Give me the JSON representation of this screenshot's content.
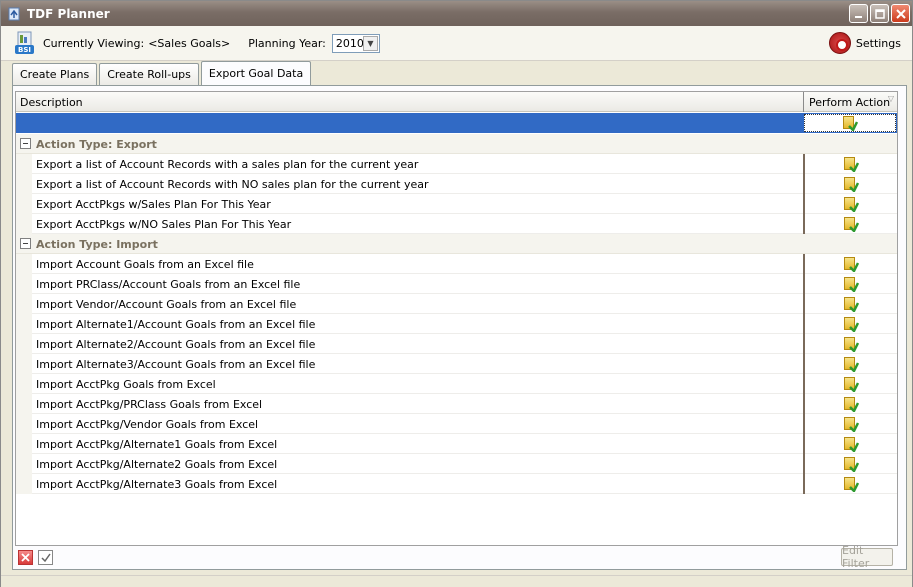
{
  "window": {
    "title": "TDF Planner"
  },
  "toolbar": {
    "viewing_label": "Currently Viewing:",
    "viewing_value": "<Sales Goals>",
    "year_label": "Planning Year:",
    "year_value": "2010",
    "settings_label": "Settings"
  },
  "tabs": [
    {
      "label": "Create Plans"
    },
    {
      "label": "Create Roll-ups"
    },
    {
      "label": "Export Goal Data"
    }
  ],
  "grid": {
    "columns": {
      "description": "Description",
      "action": "Perform Action"
    },
    "groups": [
      {
        "title": "Action Type: Export",
        "rows": [
          "Export a list of Account Records with a sales plan for the current year",
          "Export a list of Account Records with NO sales plan for the current year",
          "Export AcctPkgs w/Sales Plan For This Year",
          "Export AcctPkgs w/NO Sales Plan For This Year"
        ]
      },
      {
        "title": "Action Type: Import",
        "rows": [
          "Import Account Goals from an Excel file",
          "Import PRClass/Account Goals from an Excel file",
          "Import Vendor/Account Goals from an Excel file",
          "Import Alternate1/Account Goals from an Excel file",
          "Import Alternate2/Account Goals from an Excel file",
          "Import Alternate3/Account Goals from an Excel file",
          "Import AcctPkg Goals from Excel",
          "Import AcctPkg/PRClass Goals from Excel",
          "Import AcctPkg/Vendor Goals from Excel",
          "Import AcctPkg/Alternate1 Goals from Excel",
          "Import AcctPkg/Alternate2 Goals from Excel",
          "Import AcctPkg/Alternate3 Goals from Excel"
        ]
      }
    ]
  },
  "footer": {
    "edit_filter_label": "Edit Filter"
  },
  "icons": {
    "app": "planner-icon",
    "bsi": "bsi-logo-icon",
    "settings": "gear-icon",
    "action": "export-action-icon"
  },
  "colors": {
    "selected_row": "#316ac5",
    "group_title": "#7a7160",
    "title_bar": "#7a6d66"
  }
}
